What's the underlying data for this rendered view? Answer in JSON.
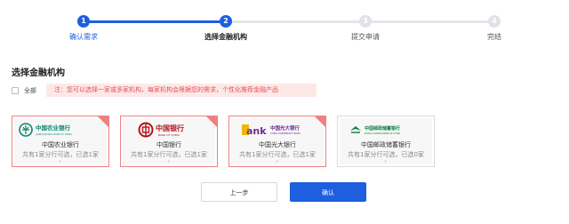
{
  "stepper": {
    "steps": [
      {
        "number": "1",
        "label": "确认需求"
      },
      {
        "number": "2",
        "label": "选择金融机构"
      },
      {
        "number": "3",
        "label": "提交申请"
      },
      {
        "number": "4",
        "label": "完结"
      }
    ]
  },
  "section": {
    "title": "选择金融机构",
    "select_all_label": "全部",
    "notice": "注：您可以选择一家或多家机构，每家机构会根据您的需求，个性化推荐金融产品"
  },
  "banks": [
    {
      "logo_text": "中国农业银行",
      "logo_sub": "AGRICULTURAL BANK OF CHINA",
      "name": "中国农业银行",
      "info": "共有1家分行可选，已选1家",
      "mark": "✓",
      "selected": true,
      "logo_color": "#0b8a6b",
      "icon": "abc-logo-icon"
    },
    {
      "logo_text": "中国银行",
      "logo_sub": "BANK OF CHINA",
      "name": "中国银行",
      "info": "共有1家分行可选，已选1家",
      "mark": "✓",
      "selected": true,
      "logo_color": "#b0151c",
      "icon": "boc-logo-icon"
    },
    {
      "logo_text": "中国光大银行",
      "logo_sub": "CHINA EVERBRIGHT BANK",
      "name": "中国光大银行",
      "info": "共有1家分行可选，已选1家",
      "mark": "✓",
      "selected": true,
      "logo_color": "#6a2c91",
      "icon": "ceb-logo-icon"
    },
    {
      "logo_text": "中国邮政储蓄银行",
      "logo_sub": "POSTAL SAVINGS BANK OF CHINA",
      "name": "中国邮政储蓄银行",
      "info": "共有1家分行可选，已选0家",
      "mark": "✓",
      "selected": false,
      "logo_color": "#0a7b3e",
      "icon": "psbc-logo-icon"
    }
  ],
  "actions": {
    "prev_label": "上一步",
    "confirm_label": "确认"
  },
  "colors": {
    "accent": "#1e5fe0",
    "selected_border": "#f08080",
    "notice_bg": "#fde8e8",
    "notice_text": "#e25252"
  }
}
